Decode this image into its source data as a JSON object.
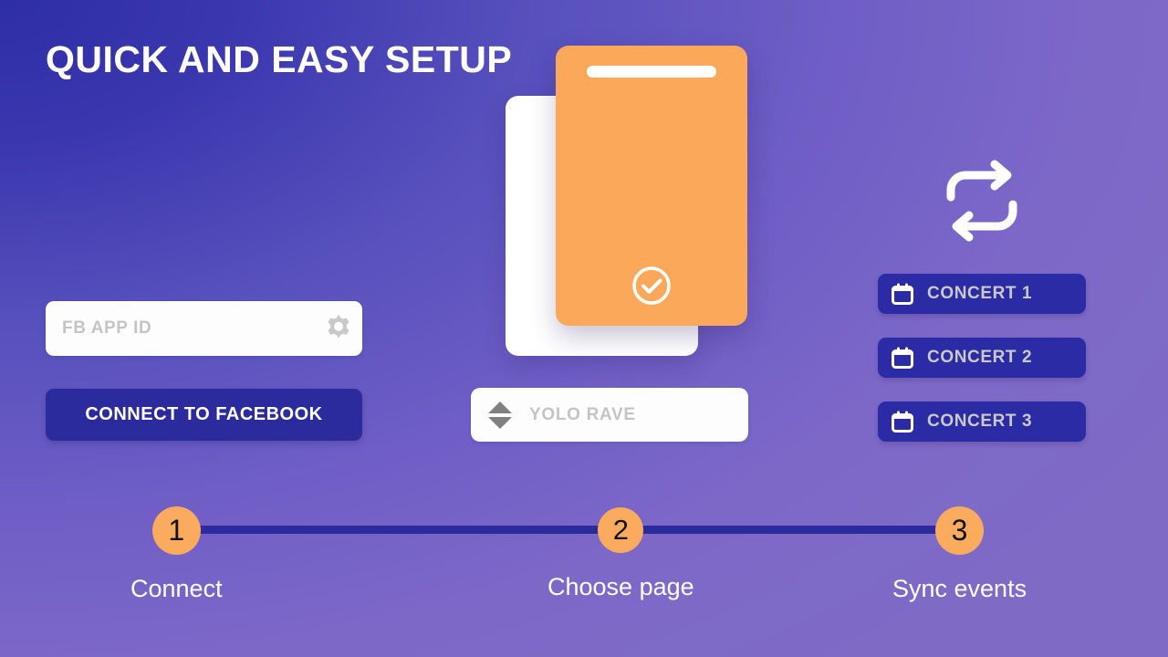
{
  "header": {
    "title": "QUICK AND EASY SETUP"
  },
  "connect_panel": {
    "app_id_placeholder": "FB APP ID",
    "app_id_value": "",
    "gear_icon": "gear-icon",
    "connect_label": "CONNECT TO FACEBOOK"
  },
  "card_stack": {
    "back_card": "white-card",
    "front_card": "orange-card",
    "check_icon": "check-circle-icon"
  },
  "page_picker": {
    "placeholder": "YOLO RAVE",
    "value": "",
    "up_icon": "triangle-up-icon",
    "down_icon": "triangle-down-icon"
  },
  "events_panel": {
    "sync_icon": "sync-repeat-icon",
    "items": [
      {
        "label": "CONCERT 1",
        "icon": "calendar-icon"
      },
      {
        "label": "CONCERT 2",
        "icon": "calendar-icon"
      },
      {
        "label": "CONCERT 3",
        "icon": "calendar-icon"
      }
    ]
  },
  "progress": {
    "steps": [
      {
        "number": "1",
        "label": "Connect"
      },
      {
        "number": "2",
        "label": "Choose page"
      },
      {
        "number": "3",
        "label": "Sync events"
      }
    ]
  },
  "colors": {
    "bg_dark": "#2e2ea6",
    "bg_light": "#7f6bc6",
    "accent_orange": "#fba85a",
    "deep_indigo": "#2b2b9e",
    "button_indigo": "#2b2ba5",
    "muted_text": "#c4c4c4",
    "white": "#ffffff"
  }
}
